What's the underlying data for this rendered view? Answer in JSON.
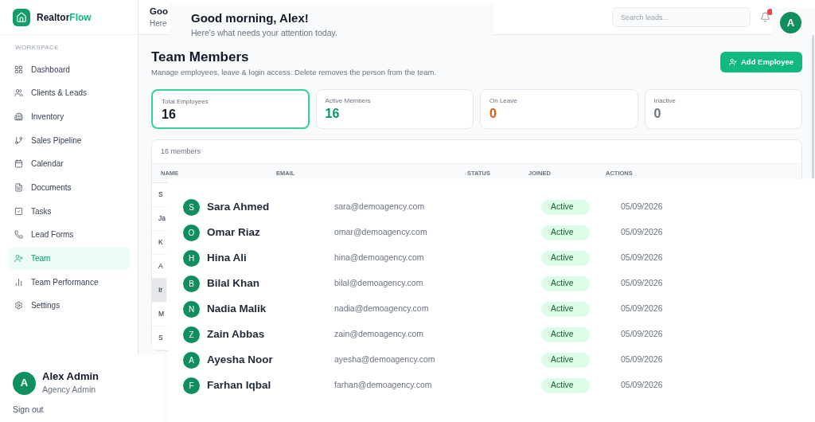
{
  "sidebar": {
    "brand": {
      "first": "Realtor",
      "second": "Flow"
    },
    "section": "WORKSPACE",
    "items": [
      {
        "label": "Dashboard",
        "selected": false
      },
      {
        "label": "Clients & Leads",
        "selected": false
      },
      {
        "label": "Inventory",
        "selected": false
      },
      {
        "label": "Sales Pipeline",
        "selected": false
      },
      {
        "label": "Calendar",
        "selected": false
      },
      {
        "label": "Documents",
        "selected": false
      },
      {
        "label": "Tasks",
        "selected": false
      },
      {
        "label": "Lead Forms",
        "selected": false
      },
      {
        "label": "Team",
        "selected": true
      },
      {
        "label": "Team Performance",
        "selected": false
      },
      {
        "label": "Settings",
        "selected": false
      }
    ],
    "user": {
      "initial": "A",
      "name": "Alex Admin",
      "role": "Agency Admin",
      "sign_out": "Sign out"
    }
  },
  "header": {
    "title": "Goo",
    "subtitle": "Here",
    "search": {
      "placeholder": "Search leads..."
    }
  },
  "page": {
    "title": "Team Members",
    "subtitle": "Manage employees, leave & login access. Delete removes the person from the team.",
    "add_button": "Add Employee"
  },
  "stats": [
    {
      "label": "Total Employees",
      "value": "16",
      "color": "#111827",
      "selected": true
    },
    {
      "label": "Active Members",
      "value": "16",
      "color": "#059669",
      "selected": false
    },
    {
      "label": "On Leave",
      "value": "0",
      "color": "#ea580c",
      "selected": false
    },
    {
      "label": "Inactive",
      "value": "0",
      "color": "#6b7280",
      "selected": false
    }
  ],
  "table": {
    "count": "16 members",
    "columns": [
      "NAME",
      "EMAIL",
      "STATUS",
      "JOINED",
      "ACTIONS"
    ],
    "rows": [
      {
        "name": "S",
        "selected": false
      },
      {
        "name": "Ja",
        "selected": false
      },
      {
        "name": "K",
        "selected": false
      },
      {
        "name": "A",
        "selected": false
      },
      {
        "name": "Ir",
        "selected": true
      },
      {
        "name": "M",
        "selected": false
      },
      {
        "name": "S",
        "selected": false
      }
    ]
  },
  "greeting_overlay": {
    "title": "Good morning, Alex!",
    "subtitle": "Here's what needs your attention today."
  },
  "profile_overlay": {
    "initial": "A"
  },
  "members_overlay": {
    "members": [
      {
        "initial": "S",
        "name": "Sara Ahmed",
        "email": "sara@demoagency.com",
        "status": "Active",
        "joined": "05/09/2026"
      },
      {
        "initial": "O",
        "name": "Omar Riaz",
        "email": "omar@demoagency.com",
        "status": "Active",
        "joined": "05/09/2026"
      },
      {
        "initial": "H",
        "name": "Hina Ali",
        "email": "hina@demoagency.com",
        "status": "Active",
        "joined": "05/09/2026"
      },
      {
        "initial": "B",
        "name": "Bilal Khan",
        "email": "bilal@demoagency.com",
        "status": "Active",
        "joined": "05/09/2026"
      },
      {
        "initial": "N",
        "name": "Nadia Malik",
        "email": "nadia@demoagency.com",
        "status": "Active",
        "joined": "05/09/2026"
      },
      {
        "initial": "Z",
        "name": "Zain Abbas",
        "email": "zain@demoagency.com",
        "status": "Active",
        "joined": "05/09/2026"
      },
      {
        "initial": "A",
        "name": "Ayesha Noor",
        "email": "ayesha@demoagency.com",
        "status": "Active",
        "joined": "05/09/2026"
      },
      {
        "initial": "F",
        "name": "Farhan Iqbal",
        "email": "farhan@demoagency.com",
        "status": "Active",
        "joined": "05/09/2026"
      }
    ]
  }
}
